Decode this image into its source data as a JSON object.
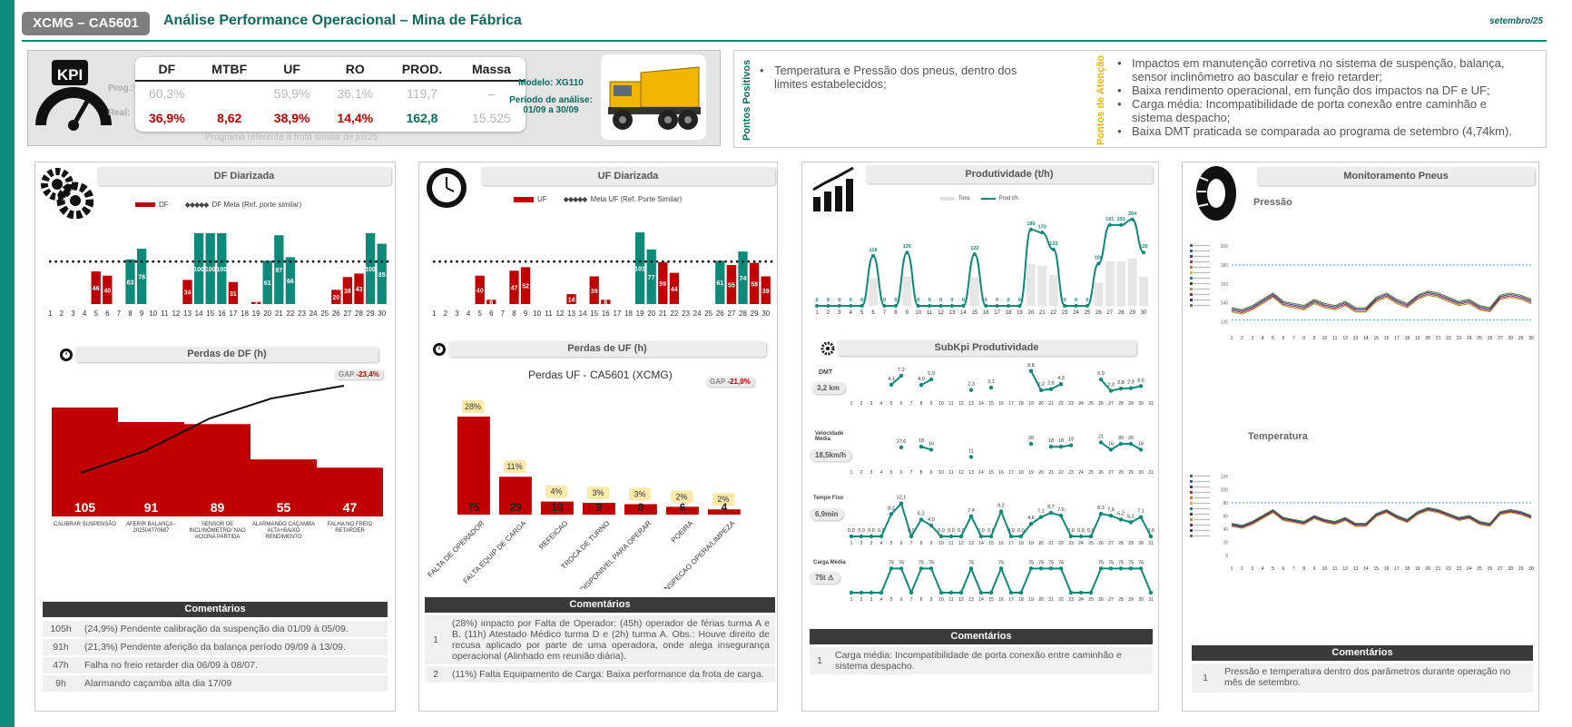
{
  "header": {
    "tag": "XCMG – CA5601",
    "title": "Análise Performance Operacional – Mina de Fábrica",
    "date": "setembro/25"
  },
  "kpi": {
    "columns": [
      "DF",
      "MTBF",
      "UF",
      "RO",
      "PROD.",
      "Massa"
    ],
    "prog_label": "Prog.:",
    "real_label": "Real:",
    "prog": [
      "60,3%",
      "",
      "59,9%",
      "36,1%",
      "119,7",
      "–"
    ],
    "real": [
      "36,9%",
      "8,62",
      "38,9%",
      "14,4%",
      "162,8",
      "15.525"
    ],
    "note": "Programa referente a frota similar de jul/25",
    "model": "Modelo: XG110",
    "period_label": "Período de análise:",
    "period": "01/09 a 30/09",
    "icon_text": "KPI"
  },
  "pontos": {
    "pos_label": "Pontos Positivos",
    "att_label": "Pontos de Atenção",
    "positivos": [
      "Temperatura e Pressão dos pneus, dentro dos limites estabelecidos;"
    ],
    "atencao": [
      "Impactos em manutenção corretiva no sistema de suspenção, balança, sensor inclinômetro ao bascular e freio retarder;",
      "Baixa rendimento operacional, em função dos impactos na DF e UF;",
      "Carga média: Incompatibilidade de porta conexão entre caminhão e sistema despacho;",
      "Baixa DMT praticada se comparada ao programa de setembro (4,74km)."
    ]
  },
  "df": {
    "title": "DF Diarizada",
    "legend_bar": "DF",
    "legend_meta": "DF Meta (Ref. porte similar)",
    "perdas_title": "Perdas de DF (h)",
    "gap_label": "GAP",
    "gap_value": "-23,4%",
    "pareto_values": [
      "105",
      "91",
      "89",
      "55",
      "47"
    ],
    "pareto_labels": [
      "CALIBRAR SUSPENSÃO",
      "AFERIR BALANÇA - 202504770687",
      "SENSOR DE INCLINÔMETRO/ NAO ACIONA PARTIDA",
      "ALARMANDO CAÇAMBA ALTA+BAIXO RENDIMENTO",
      "FALHA NO FREIO RETARDER"
    ],
    "comments_title": "Comentários",
    "comments": [
      {
        "k": "105h",
        "v": "(24,9%) Pendente calibração da suspenção dia 01/09 à 05/09."
      },
      {
        "k": "91h",
        "v": "(21,3%) Pendente aferição da balança período 09/09 à 13/09."
      },
      {
        "k": "47h",
        "v": "Falha no freio retarder dia  06/09 à 08/07."
      },
      {
        "k": "9h",
        "v": "Alarmando caçamba alta dia 17/09"
      }
    ]
  },
  "uf": {
    "title": "UF Diarizada",
    "legend_bar": "UF",
    "legend_meta": "Meta UF (Ref. Porte Similar)",
    "perdas_title": "Perdas de UF (h)",
    "chart_title": "Perdas UF - CA5601 (XCMG)",
    "gap_label": "GAP",
    "gap_value": "-21,0%",
    "comments_title": "Comentários",
    "comments": [
      {
        "k": "1",
        "v": "(28%) impacto por Falta de Operador: (45h) operador de férias turma A e B. (11h) Atestado Médico turma D e (2h) turma A. Obs.: Houve direito de recusa aplicado por parte de uma operadora, onde alega insegurança operacional (Alinhado em reunião diária)."
      },
      {
        "k": "2",
        "v": "(11%) Falta Equipamento de Carga: Baixa performance da frota de carga."
      }
    ]
  },
  "prod": {
    "title": "Produtividade (t/h)",
    "legend_tons": "Tons",
    "legend_prod": "Prod t/h",
    "subkpi_title": "SubKpi Produtividade",
    "dmt_label": "DMT",
    "dmt_value": "3,2 km",
    "vel_label": "Velocidade Média",
    "vel_value": "18,5km/h",
    "tfixo_label": "Tempo Fixo",
    "tfixo_value": "6,9min",
    "carga_label": "Carga Média",
    "carga_value": "75t",
    "comments_title": "Comentários",
    "comments": [
      {
        "k": "1",
        "v": "Carga média: Incompatibilidade de porta conexão entre caminhão e sistema despacho."
      }
    ]
  },
  "pneus": {
    "title": "Monitoramento Pneus",
    "pressao": "Pressão",
    "temperatura": "Temperatura",
    "comments_title": "Comentários",
    "comments": [
      {
        "k": "1",
        "v": "Pressão e temperatura dentro dos parâmetros durante operação no mês de setembro."
      }
    ]
  },
  "chart_data": [
    {
      "type": "bar",
      "title": "DF Diarizada",
      "categories": [
        "1",
        "2",
        "3",
        "4",
        "5",
        "6",
        "7",
        "8",
        "9",
        "10",
        "11",
        "12",
        "13",
        "14",
        "15",
        "16",
        "17",
        "18",
        "19",
        "20",
        "21",
        "22",
        "23",
        "24",
        "25",
        "26",
        "27",
        "28",
        "29",
        "30"
      ],
      "series": [
        {
          "name": "DF",
          "values": [
            null,
            null,
            null,
            null,
            46,
            40,
            null,
            63,
            78,
            null,
            null,
            null,
            34,
            100,
            100,
            100,
            31,
            null,
            3,
            61,
            97,
            66,
            null,
            null,
            null,
            20,
            38,
            43,
            100,
            85
          ]
        },
        {
          "name": "DF Meta (Ref. porte similar)",
          "values": [
            60,
            60,
            60,
            60,
            60,
            60,
            60,
            60,
            60,
            60,
            60,
            60,
            60,
            60,
            60,
            60,
            60,
            60,
            60,
            60,
            60,
            60,
            60,
            60,
            60,
            60,
            60,
            60,
            60,
            60
          ]
        }
      ]
    },
    {
      "type": "bar",
      "title": "UF Diarizada",
      "categories": [
        "1",
        "2",
        "3",
        "4",
        "5",
        "6",
        "7",
        "8",
        "9",
        "10",
        "11",
        "12",
        "13",
        "14",
        "15",
        "16",
        "17",
        "18",
        "19",
        "20",
        "21",
        "22",
        "23",
        "24",
        "25",
        "26",
        "27",
        "28",
        "29",
        "30"
      ],
      "series": [
        {
          "name": "UF",
          "values": [
            null,
            null,
            null,
            null,
            40,
            6,
            null,
            47,
            52,
            null,
            null,
            null,
            14,
            null,
            39,
            6,
            null,
            null,
            101,
            77,
            59,
            44,
            null,
            null,
            null,
            61,
            55,
            74,
            58,
            39
          ]
        },
        {
          "name": "Meta UF (Ref. Porte Similar)",
          "values": [
            60,
            60,
            60,
            60,
            60,
            60,
            60,
            60,
            60,
            60,
            60,
            60,
            60,
            60,
            60,
            60,
            60,
            60,
            60,
            60,
            60,
            60,
            60,
            60,
            60,
            60,
            60,
            60,
            60,
            60
          ]
        }
      ]
    },
    {
      "type": "bar",
      "title": "Perdas UF - CA5601 (XCMG)",
      "categories": [
        "FALTA DE OPERADOR",
        "FALTA EQUIP DE CARGA",
        "REFEICAO",
        "TROCA DE TURNO",
        "DISPONIVEL PARA OPERAR",
        "POEIRA",
        "INSPECAO OPERA/LIMPEZA"
      ],
      "values": [
        75,
        29,
        10,
        9,
        8,
        6,
        4
      ],
      "percent_labels": [
        "28%",
        "11%",
        "4%",
        "3%",
        "3%",
        "2%",
        "2%"
      ]
    },
    {
      "type": "line",
      "title": "Produtividade (t/h)",
      "x": [
        "1",
        "2",
        "3",
        "4",
        "5",
        "6",
        "7",
        "8",
        "9",
        "10",
        "11",
        "12",
        "13",
        "14",
        "15",
        "16",
        "17",
        "18",
        "19",
        "20",
        "21",
        "22",
        "23",
        "24",
        "25",
        "26",
        "27",
        "28",
        "29",
        "30"
      ],
      "series": [
        {
          "name": "Prod t/h",
          "values": [
            0,
            0,
            0,
            0,
            0,
            118,
            0,
            0,
            126,
            0,
            0,
            0,
            0,
            0,
            122,
            0,
            0,
            0,
            0,
            180,
            173,
            133,
            0,
            0,
            0,
            100,
            191,
            191,
            204,
            126
          ]
        }
      ]
    }
  ]
}
